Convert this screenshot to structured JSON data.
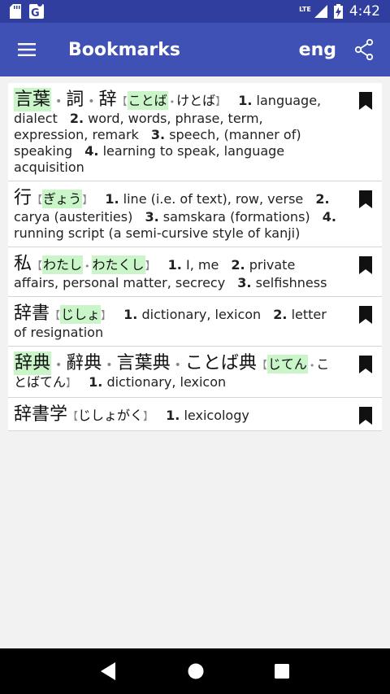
{
  "status": {
    "time": "4:42",
    "network": "LTE"
  },
  "appbar": {
    "title": "Bookmarks",
    "language": "eng"
  },
  "entries": [
    {
      "words": [
        "言葉",
        "詞",
        "辞"
      ],
      "readings": [
        "ことば",
        "けとば"
      ],
      "senses": [
        {
          "n": "1.",
          "t": "language, dialect"
        },
        {
          "n": "2.",
          "t": "word, words, phrase, term, expression, remark"
        },
        {
          "n": "3.",
          "t": "speech, (manner of) speaking"
        },
        {
          "n": "4.",
          "t": "learning to speak, language acquisition"
        }
      ]
    },
    {
      "words": [
        "行"
      ],
      "readings": [
        "ぎょう"
      ],
      "senses": [
        {
          "n": "1.",
          "t": "line (i.e. of text), row, verse"
        },
        {
          "n": "2.",
          "t": "carya (austerities)"
        },
        {
          "n": "3.",
          "t": "samskara (formations)"
        },
        {
          "n": "4.",
          "t": "running script (a semi-cursive style of kanji)"
        }
      ]
    },
    {
      "words": [
        "私"
      ],
      "readings": [
        "わたし",
        "わたくし"
      ],
      "senses": [
        {
          "n": "1.",
          "t": "I, me"
        },
        {
          "n": "2.",
          "t": "private affairs, personal matter, secrecy"
        },
        {
          "n": "3.",
          "t": "selfishness"
        }
      ]
    },
    {
      "words": [
        "辞書"
      ],
      "readings": [
        "じしょ"
      ],
      "senses": [
        {
          "n": "1.",
          "t": "dictionary, lexicon"
        },
        {
          "n": "2.",
          "t": "letter of resignation"
        }
      ]
    },
    {
      "words": [
        "辞典",
        "辭典",
        "言葉典",
        "ことば典"
      ],
      "readings": [
        "じてん",
        "ことばてん"
      ],
      "senses": [
        {
          "n": "1.",
          "t": "dictionary, lexicon"
        }
      ]
    },
    {
      "words": [
        "辞書学"
      ],
      "readings": [
        "じしょがく"
      ],
      "senses": [
        {
          "n": "1.",
          "t": "lexicology"
        }
      ]
    }
  ]
}
